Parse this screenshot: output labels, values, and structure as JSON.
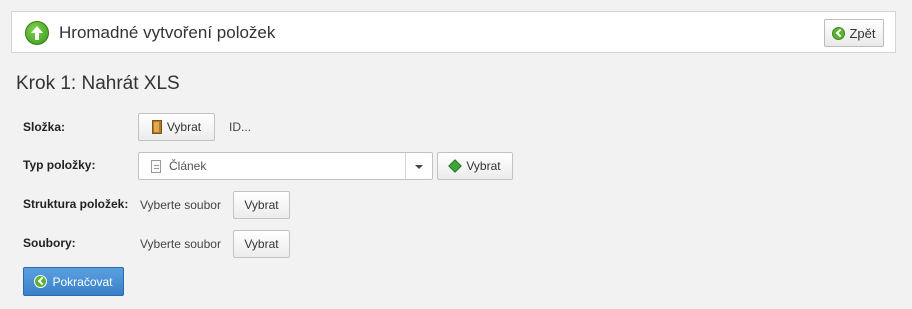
{
  "header": {
    "title": "Hromadné vytvoření položek",
    "icon": "upload-arrow-icon",
    "back_label": "Zpět"
  },
  "step_title": "Krok 1: Nahrát XLS",
  "form": {
    "folder": {
      "label": "Složka:",
      "button_label": "Vybrat",
      "value_text": "ID..."
    },
    "item_type": {
      "label": "Typ položky:",
      "selected": "Článek",
      "button_label": "Vybrat"
    },
    "structure": {
      "label": "Struktura položek:",
      "value_text": "Vyberte soubor",
      "button_label": "Vybrat"
    },
    "files": {
      "label": "Soubory:",
      "value_text": "Vyberte soubor",
      "button_label": "Vybrat"
    }
  },
  "continue_label": "Pokračovat",
  "colors": {
    "primary": "#3a80c9",
    "accent_green": "#5cb131"
  }
}
